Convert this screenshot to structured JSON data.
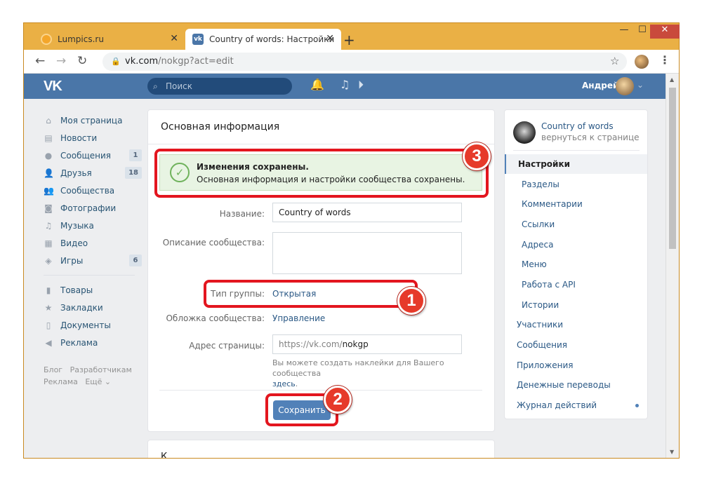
{
  "browser": {
    "tabs": [
      {
        "title": "Lumpics.ru"
      },
      {
        "title": "Country of words: Настройки"
      }
    ],
    "new_tab": "+",
    "url_host": "vk.com",
    "url_path": "/nokgp?act=edit"
  },
  "vk": {
    "search_placeholder": "Поиск",
    "user_name": "Андрей",
    "left_menu": [
      {
        "label": "Моя страница",
        "icon": "home-icon"
      },
      {
        "label": "Новости",
        "icon": "news-icon"
      },
      {
        "label": "Сообщения",
        "icon": "message-icon",
        "count": "1"
      },
      {
        "label": "Друзья",
        "icon": "friends-icon",
        "count": "18"
      },
      {
        "label": "Сообщества",
        "icon": "groups-icon"
      },
      {
        "label": "Фотографии",
        "icon": "camera-icon"
      },
      {
        "label": "Музыка",
        "icon": "music-icon"
      },
      {
        "label": "Видео",
        "icon": "video-icon"
      },
      {
        "label": "Игры",
        "icon": "games-icon",
        "count": "6"
      }
    ],
    "left_menu2": [
      {
        "label": "Товары",
        "icon": "bag-icon"
      },
      {
        "label": "Закладки",
        "icon": "star-icon"
      },
      {
        "label": "Документы",
        "icon": "document-icon"
      },
      {
        "label": "Реклама",
        "icon": "megaphone-icon"
      }
    ],
    "footer": {
      "l1a": "Блог",
      "l1b": "Разработчикам",
      "l2a": "Реклама",
      "l2b": "Ещё ⌄"
    }
  },
  "form": {
    "title": "Основная информация",
    "notice_title": "Изменения сохранены.",
    "notice_text": "Основная информация и настройки сообщества сохранены.",
    "name_label": "Название:",
    "name_value": "Country of words",
    "desc_label": "Описание сообщества:",
    "type_label": "Тип группы:",
    "type_value": "Открытая",
    "cover_label": "Обложка сообщества:",
    "cover_value": "Управление",
    "addr_label": "Адрес страницы:",
    "addr_prefix": "https://vk.com/",
    "addr_value": "nokgp",
    "hint_text": "Вы можете создать наклейки для Вашего сообщества",
    "hint_link": "здесь",
    "save_label": "Сохранить",
    "next_section": "К..."
  },
  "annotations": {
    "b1": "1",
    "b2": "2",
    "b3": "3"
  },
  "right_menu": {
    "group_name": "Country of words",
    "back_label": "вернуться к странице",
    "items": [
      "Настройки",
      "Разделы",
      "Комментарии",
      "Ссылки",
      "Адреса",
      "Меню",
      "Работа с API",
      "Истории",
      "Участники",
      "Сообщения",
      "Приложения",
      "Денежные переводы",
      "Журнал действий"
    ]
  },
  "colors": {
    "vk_blue": "#4a76a8",
    "button": "#5181b8",
    "success_bg": "#e8f4e3",
    "annotation_red": "#e3161f",
    "chrome_frame": "#e9a93c"
  }
}
